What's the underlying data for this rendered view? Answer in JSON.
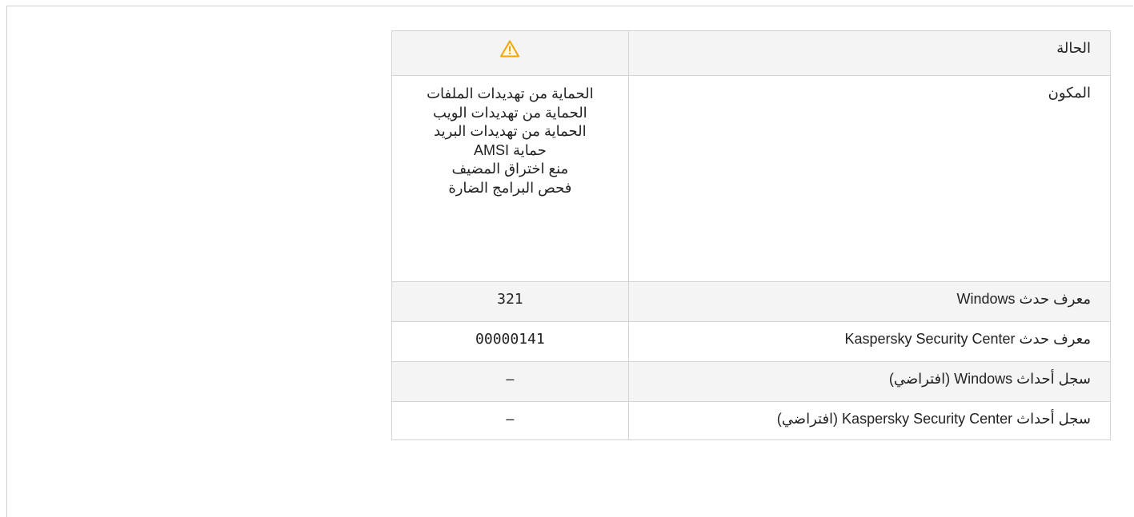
{
  "rows": {
    "status": {
      "label": "الحالة",
      "icon": "warning-icon",
      "icon_color": "#f0a500"
    },
    "component": {
      "label": "المكون",
      "values": [
        "الحماية من تهديدات الملفات",
        "الحماية من تهديدات الويب",
        "الحماية من تهديدات البريد",
        "حماية AMSI",
        "منع اختراق المضيف",
        "فحص البرامج الضارة"
      ]
    },
    "windows_event_id": {
      "label": "معرف حدث Windows",
      "value": "321"
    },
    "ksc_event_id": {
      "label": "معرف حدث Kaspersky Security Center",
      "value": "00000141"
    },
    "windows_event_log": {
      "label": "سجل أحداث Windows (افتراضي)",
      "value": "–"
    },
    "ksc_event_log": {
      "label": "سجل أحداث Kaspersky Security Center (افتراضي)",
      "value": "–"
    }
  }
}
